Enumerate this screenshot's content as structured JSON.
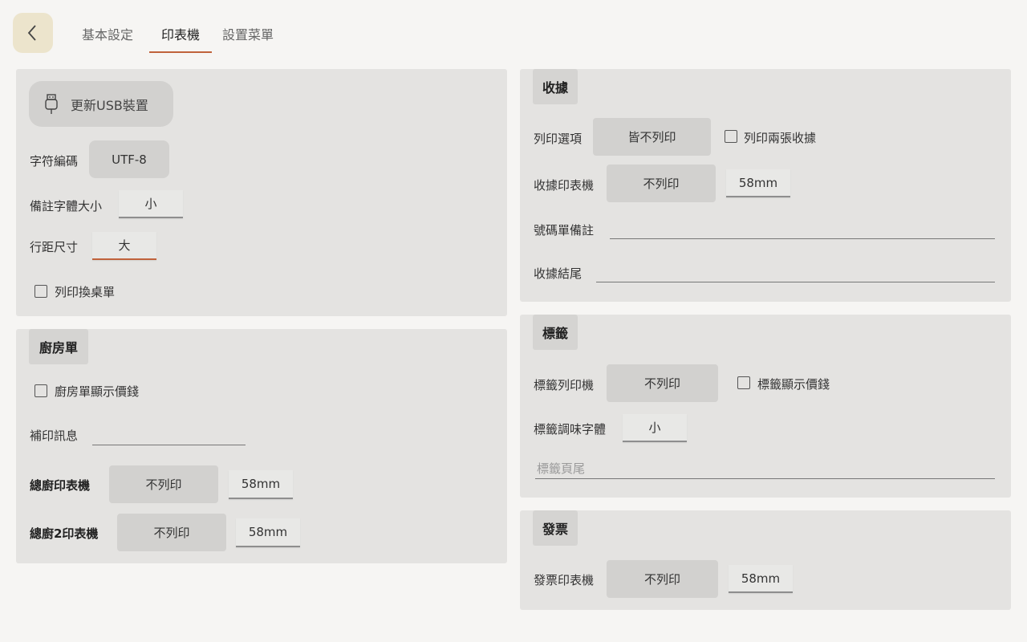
{
  "tabs": [
    {
      "label": "基本設定"
    },
    {
      "label": "印表機"
    },
    {
      "label": "設置菜單"
    }
  ],
  "left_top": {
    "refresh_usb": "更新USB裝置",
    "encoding_label": "字符編碼",
    "encoding_value": "UTF-8",
    "note_font_label": "備註字體大小",
    "note_font_value": "小",
    "line_spacing_label": "行距尺寸",
    "line_spacing_value": "大",
    "print_table_change": "列印換桌單"
  },
  "kitchen": {
    "title": "廚房單",
    "show_price": "廚房單顯示價錢",
    "reprint_label": "補印訊息",
    "main_printer_label": "總廚印表機",
    "main_printer_value": "不列印",
    "main_printer_size": "58mm",
    "main2_printer_label": "總廚2印表機",
    "main2_printer_value": "不列印",
    "main2_printer_size": "58mm"
  },
  "receipt": {
    "title": "收據",
    "print_option_label": "列印選項",
    "print_option_value": "皆不列印",
    "print_two": "列印兩張收據",
    "printer_label": "收據印表機",
    "printer_value": "不列印",
    "printer_size": "58mm",
    "number_note_label": "號碼單備註",
    "footer_label": "收據結尾"
  },
  "label": {
    "title": "標籤",
    "printer_label": "標籤列印機",
    "printer_value": "不列印",
    "show_price": "標籤顯示價錢",
    "seasoning_font_label": "標籤調味字體",
    "seasoning_font_value": "小",
    "footer_placeholder": "標籤頁尾"
  },
  "invoice": {
    "title": "發票",
    "printer_label": "發票印表機",
    "printer_value": "不列印",
    "printer_size": "58mm"
  },
  "colors": {
    "accent": "#c0623b",
    "back_button_bg": "#ece4cc",
    "panel_bg": "#e4e3e1",
    "page_bg": "#f6f5f3"
  }
}
